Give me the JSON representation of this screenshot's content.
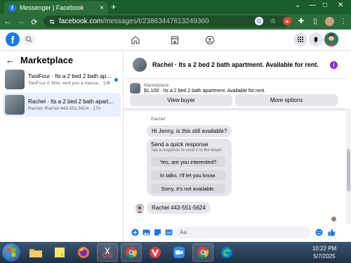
{
  "browser": {
    "tab_title": "Messenger | Facebook",
    "tab_close": "×",
    "new_tab": "+",
    "url_host": "facebook.com",
    "url_path": "/messages/t/23863447613249360"
  },
  "marketplace": {
    "title": "Marketplace",
    "conversations": [
      {
        "name": "TwoFour · Its a 2 bed 2 bath apar...",
        "preview": "TwoFour K Msic sent you a messa...",
        "time": "13h",
        "unread": true
      },
      {
        "name": "Rachel · Its a 2 bed 2 bath apart...",
        "preview": "Rachel: Rachel 443-551-5624 · 17h",
        "time": "",
        "unread": false
      }
    ]
  },
  "chat": {
    "title": "Rachel · Its a 2 bed 2 bath apartment. Available for rent.",
    "listing_label": "Marketplace",
    "listing_desc": "$1,100 · Its a 2 bed 2 bath apartment. Available for rent.",
    "view_buyer": "View buyer",
    "more_options": "More options",
    "sender_name": "Rachel",
    "message_1": "Hi Jenny, is this still available?",
    "quick_response_title": "Send a quick response",
    "quick_response_sub": "Tap a response to send it to the buyer.",
    "quick_responses": [
      "Yes, are you interested?",
      "In talks. I'll let you know.",
      "Sorry, it's not available."
    ],
    "message_2": "Rachel 443-551-5624",
    "input_placeholder": "Aa"
  },
  "taskbar": {
    "time": "10:22 PM",
    "date": "5/7/2025"
  },
  "colors": {
    "chrome_frame": "#1a5f2a",
    "facebook_blue": "#1877f2",
    "bubble_gray": "#e4e6eb",
    "active_row": "#e7f0fd"
  }
}
